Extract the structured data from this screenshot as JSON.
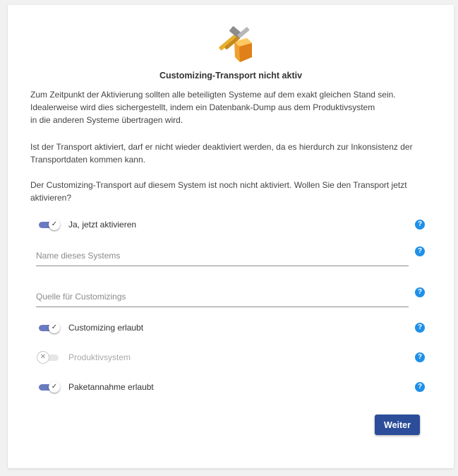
{
  "dialog": {
    "title": "Customizing-Transport nicht aktiv",
    "paragraph_1": "Zum Zeitpunkt der Aktivierung sollten alle beteiligten Systeme auf dem exakt gleichen Stand sein.\nIdealerweise wird dies sichergestellt, indem ein Datenbank-Dump aus dem Produktivsystem\nin die anderen Systeme übertragen wird.",
    "paragraph_2": "Ist der Transport aktiviert, darf er nicht wieder deaktiviert werden, da es hierdurch zur Inkonsistenz der\nTransportdaten kommen kann.",
    "paragraph_3": "Der Customizing-Transport auf diesem System ist noch nicht aktiviert. Wollen Sie den Transport jetzt\naktivieren?"
  },
  "toggles": {
    "activate": {
      "label": "Ja, jetzt aktivieren",
      "checked": true
    },
    "customizing": {
      "label": "Customizing erlaubt",
      "checked": true
    },
    "production": {
      "label": "Produktivsystem",
      "checked": false,
      "disabled": true
    },
    "package": {
      "label": "Paketannahme erlaubt",
      "checked": true
    }
  },
  "fields": {
    "system_name": {
      "placeholder": "Name dieses Systems",
      "value": ""
    },
    "customizing_source": {
      "placeholder": "Quelle für Customizings",
      "value": ""
    }
  },
  "help_glyph": "?",
  "check_glyph": "✓",
  "cross_glyph": "✕",
  "buttons": {
    "next": "Weiter"
  },
  "colors": {
    "toggle_on": "#6b7bbf",
    "help": "#1e90e8",
    "primary_button": "#2b4d9a"
  },
  "icons": {
    "hero": "hammer-box-icon",
    "help": "help-circle-icon"
  }
}
